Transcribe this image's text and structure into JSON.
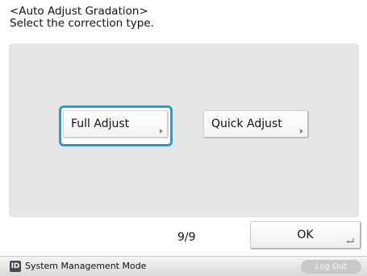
{
  "header": {
    "title": "<Auto Adjust Gradation>",
    "instruction": "Select the correction type."
  },
  "options": {
    "full_adjust": {
      "label": "Full Adjust",
      "selected": true
    },
    "quick_adjust": {
      "label": "Quick Adjust",
      "selected": false
    }
  },
  "pagination": {
    "text": "9/9"
  },
  "ok_button": {
    "label": "OK",
    "icon": "enter-icon"
  },
  "footer": {
    "mode_icon": "id-icon",
    "mode_icon_text": "ID",
    "mode_label": "System Management Mode",
    "logout_label": "Log Out"
  },
  "colors": {
    "accent": "#1e9fe0",
    "panel": "#e5e5e5",
    "logout_disabled": "#c9c9c9"
  }
}
